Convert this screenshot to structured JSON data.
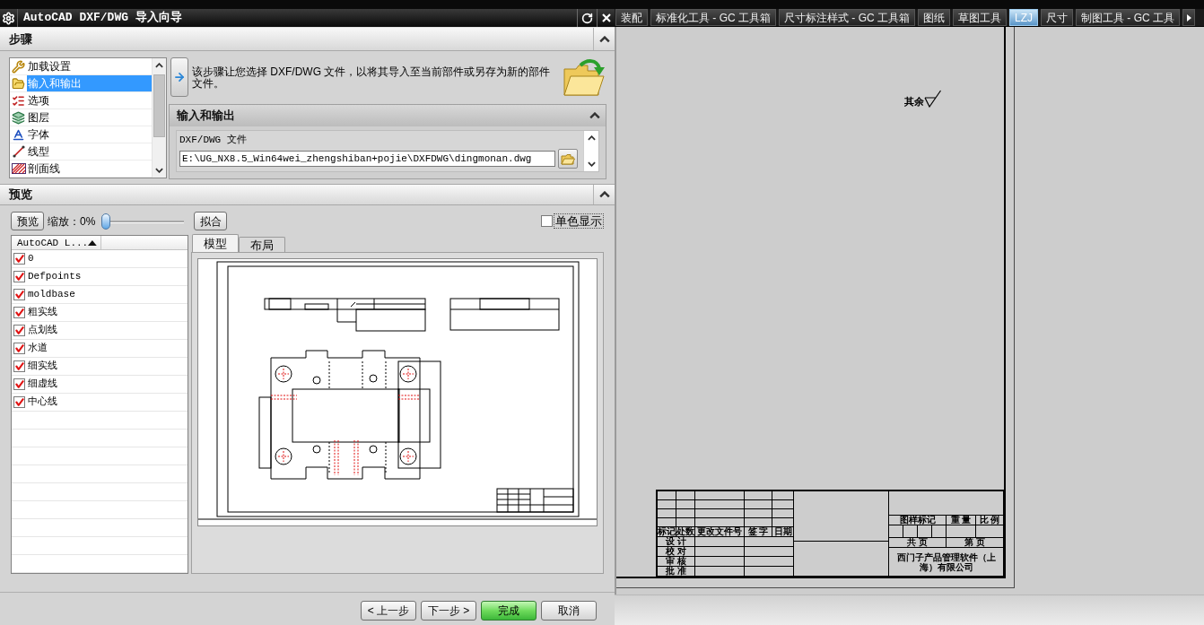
{
  "dialog": {
    "title": "AutoCAD DXF/DWG 导入向导"
  },
  "steps": {
    "title": "步骤",
    "expanded": true,
    "items": [
      {
        "label": "加载设置",
        "selected": false
      },
      {
        "label": "输入和输出",
        "selected": true
      },
      {
        "label": "选项",
        "selected": false
      },
      {
        "label": "图层",
        "selected": false
      },
      {
        "label": "字体",
        "selected": false
      },
      {
        "label": "线型",
        "selected": false
      },
      {
        "label": "剖面线",
        "selected": false
      }
    ],
    "description": "该步骤让您选择 DXF/DWG 文件，以将其导入至当前部件或另存为新的部件文件。",
    "io_group": {
      "title": "输入和输出",
      "expanded": true,
      "file_label": "DXF/DWG 文件",
      "file_path": "E:\\UG_NX8.5_Win64wei_zhengshiban+pojie\\DXFDWG\\dingmonan.dwg"
    }
  },
  "preview": {
    "title": "预览",
    "expanded": true,
    "preview_button": "预览",
    "zoom_label": "缩放：0%",
    "zoom": {
      "level": 0
    },
    "fit_button": "拟合",
    "monochrome": {
      "label": "单色显示",
      "checked": false
    },
    "layer_column": {
      "label": "AutoCAD L...",
      "sort_ascending": true
    },
    "layers": [
      {
        "name": "0",
        "checked": true
      },
      {
        "name": "Defpoints",
        "checked": true
      },
      {
        "name": "moldbase",
        "checked": true
      },
      {
        "name": "粗实线",
        "checked": true
      },
      {
        "name": "点划线",
        "checked": true
      },
      {
        "name": "水道",
        "checked": true
      },
      {
        "name": "细实线",
        "checked": true
      },
      {
        "name": "细虚线",
        "checked": true
      },
      {
        "name": "中心线",
        "checked": true
      }
    ],
    "tabs": [
      {
        "label": "模型",
        "selected": true
      },
      {
        "label": "布局",
        "selected": false
      }
    ]
  },
  "buttons": [
    {
      "label": "< 上一步",
      "kind": "default"
    },
    {
      "label": "下一步 >",
      "kind": "default"
    },
    {
      "label": "完成",
      "kind": "primary"
    },
    {
      "label": "取消",
      "kind": "default"
    }
  ],
  "ribbon_tabs": [
    {
      "label": "装配",
      "selected": false
    },
    {
      "label": "标准化工具 - GC 工具箱",
      "selected": false
    },
    {
      "label": "尺寸标注样式 - GC 工具箱",
      "selected": false
    },
    {
      "label": "图纸",
      "selected": false
    },
    {
      "label": "草图工具",
      "selected": false
    },
    {
      "label": "LZJ",
      "selected": true
    },
    {
      "label": "尺寸",
      "selected": false
    },
    {
      "label": "制图工具 - GC 工具",
      "selected": false
    }
  ],
  "drawing_sheet": {
    "note": "其余",
    "title_block": {
      "revision_headers": [
        "标记",
        "处数",
        "更改文件号",
        "签 字",
        "日期"
      ],
      "approval_labels": [
        "设 计",
        "校 对",
        "审 核",
        "批 准"
      ],
      "info_headers": [
        "图样标记",
        "重 量",
        "比 例"
      ],
      "sheet_labels": [
        "共 页",
        "第 页"
      ],
      "company": "西门子产品管理软件（上海）有限公司"
    }
  }
}
